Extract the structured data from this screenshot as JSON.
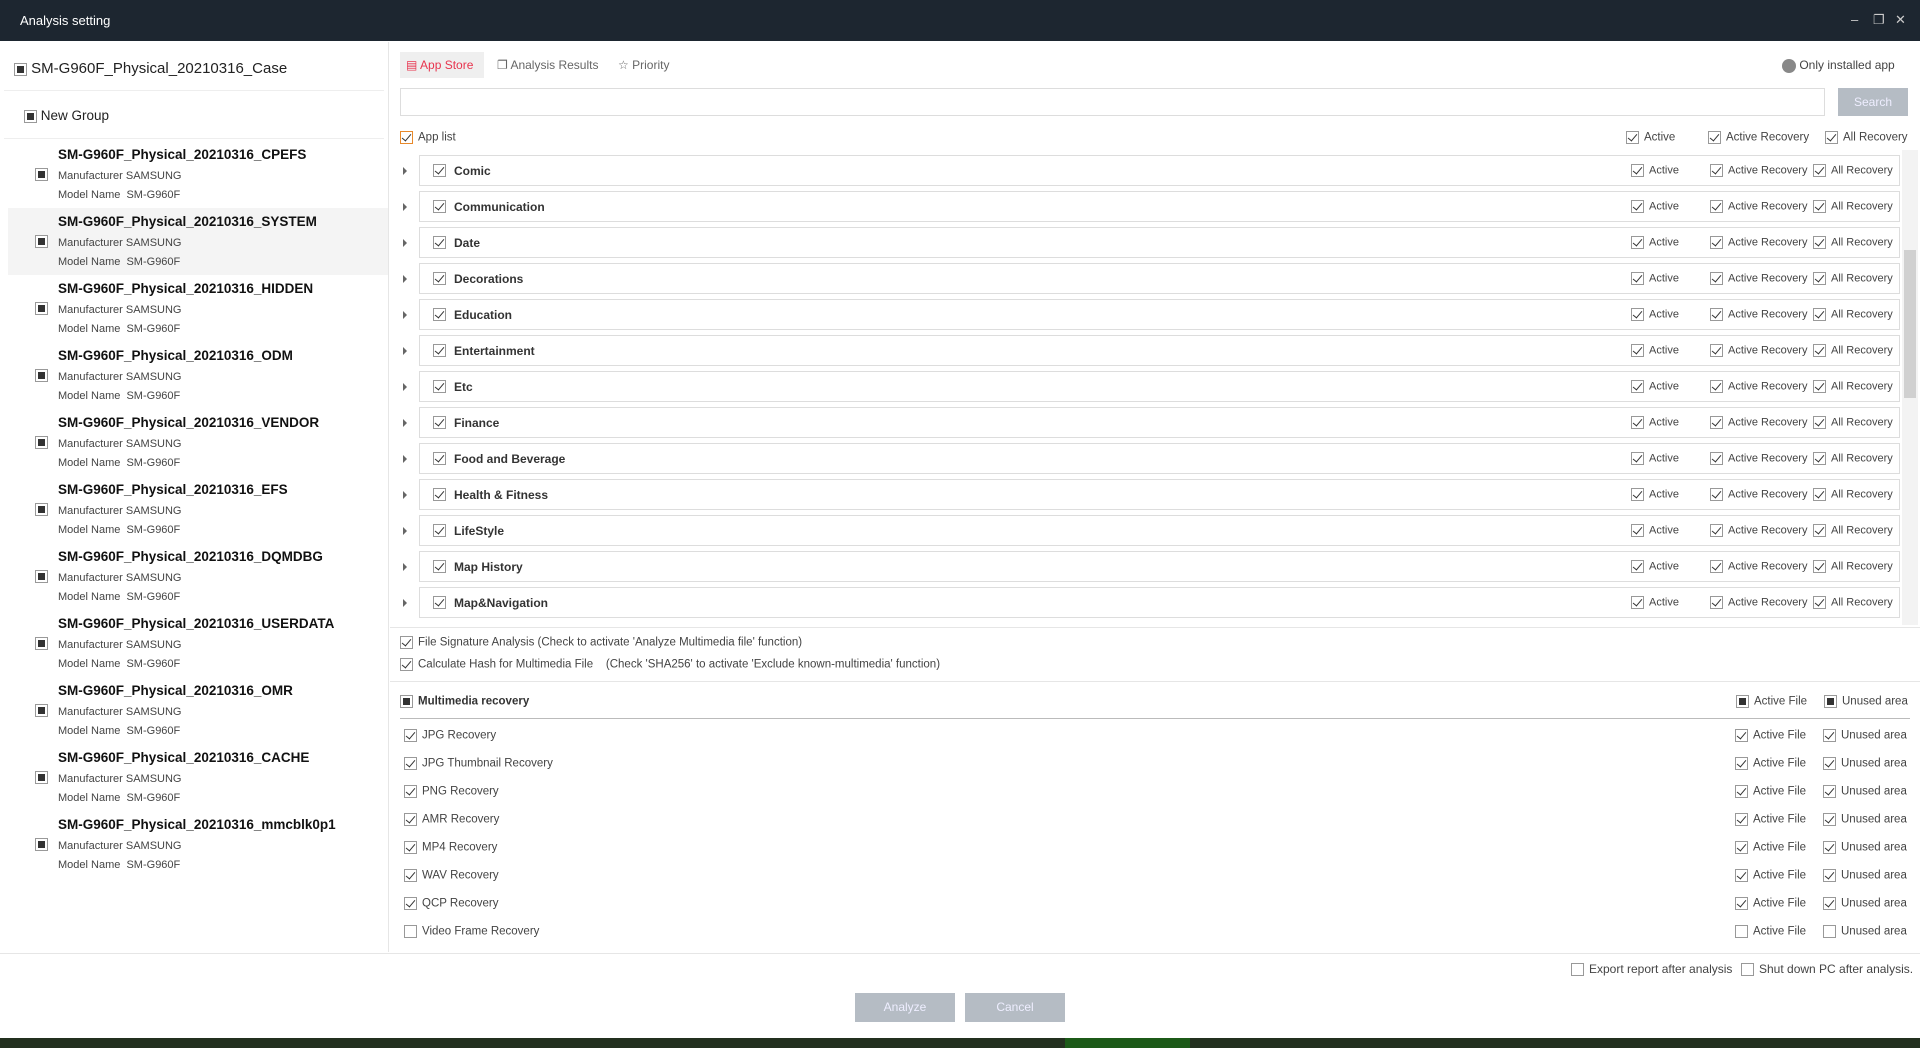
{
  "window": {
    "title": "Analysis setting"
  },
  "left": {
    "case": "SM-G960F_Physical_20210316_Case",
    "group": "New Group",
    "devices": [
      {
        "name": "SM-G960F_Physical_20210316_CPEFS",
        "manufacturer": "Manufacturer SAMSUNG",
        "model": "Model Name  SM-G960F"
      },
      {
        "name": "SM-G960F_Physical_20210316_SYSTEM",
        "manufacturer": "Manufacturer SAMSUNG",
        "model": "Model Name  SM-G960F"
      },
      {
        "name": "SM-G960F_Physical_20210316_HIDDEN",
        "manufacturer": "Manufacturer SAMSUNG",
        "model": "Model Name  SM-G960F"
      },
      {
        "name": "SM-G960F_Physical_20210316_ODM",
        "manufacturer": "Manufacturer SAMSUNG",
        "model": "Model Name  SM-G960F"
      },
      {
        "name": "SM-G960F_Physical_20210316_VENDOR",
        "manufacturer": "Manufacturer SAMSUNG",
        "model": "Model Name  SM-G960F"
      },
      {
        "name": "SM-G960F_Physical_20210316_EFS",
        "manufacturer": "Manufacturer SAMSUNG",
        "model": "Model Name  SM-G960F"
      },
      {
        "name": "SM-G960F_Physical_20210316_DQMDBG",
        "manufacturer": "Manufacturer SAMSUNG",
        "model": "Model Name  SM-G960F"
      },
      {
        "name": "SM-G960F_Physical_20210316_USERDATA",
        "manufacturer": "Manufacturer SAMSUNG",
        "model": "Model Name  SM-G960F"
      },
      {
        "name": "SM-G960F_Physical_20210316_OMR",
        "manufacturer": "Manufacturer SAMSUNG",
        "model": "Model Name  SM-G960F"
      },
      {
        "name": "SM-G960F_Physical_20210316_CACHE",
        "manufacturer": "Manufacturer SAMSUNG",
        "model": "Model Name  SM-G960F"
      },
      {
        "name": "SM-G960F_Physical_20210316_mmcblk0p1",
        "manufacturer": "Manufacturer SAMSUNG",
        "model": "Model Name  SM-G960F"
      }
    ]
  },
  "tabs": [
    {
      "label": "App Store",
      "active": true
    },
    {
      "label": "Analysis Results"
    },
    {
      "label": "Priority"
    }
  ],
  "only_installed": "Only installed app",
  "search": {
    "value": "",
    "placeholder": "",
    "button": "Search"
  },
  "applist": {
    "label": "App list",
    "active": "Active",
    "active_recovery": "Active Recovery",
    "all_recovery": "All Recovery",
    "categories": [
      "Comic",
      "Communication",
      "Date",
      "Decorations",
      "Education",
      "Entertainment",
      "Etc",
      "Finance",
      "Food and Beverage",
      "Health & Fitness",
      "LifeStyle",
      "Map History",
      "Map&Navigation"
    ]
  },
  "file_signature": "File Signature Analysis (Check to activate 'Analyze Multimedia file' function)",
  "calc_hash": "Calculate Hash for Multimedia File    (Check 'SHA256' to activate 'Exclude known-multimedia' function)",
  "multimedia": {
    "label": "Multimedia recovery",
    "active_file": "Active File",
    "unused_area": "Unused area",
    "items": [
      {
        "label": "JPG Recovery",
        "checked": true
      },
      {
        "label": "JPG Thumbnail Recovery",
        "checked": true
      },
      {
        "label": "PNG Recovery",
        "checked": true
      },
      {
        "label": "AMR Recovery",
        "checked": true
      },
      {
        "label": "MP4 Recovery",
        "checked": true
      },
      {
        "label": "WAV Recovery",
        "checked": true
      },
      {
        "label": "QCP Recovery",
        "checked": true
      },
      {
        "label": "Video Frame Recovery",
        "checked": false
      }
    ]
  },
  "footer": {
    "export": "Export report after analysis",
    "shutdown": "Shut down PC after analysis.",
    "analyze": "Analyze",
    "cancel": "Cancel"
  },
  "colors": {
    "titlebar": "#1d2630",
    "accent": "#e8344e",
    "button": "#b5bcc4"
  }
}
